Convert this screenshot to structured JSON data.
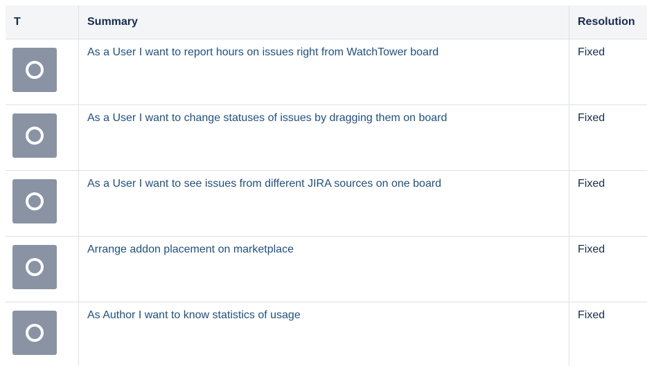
{
  "table": {
    "headers": {
      "type": "T",
      "summary": "Summary",
      "resolution": "Resolution"
    },
    "rows": [
      {
        "icon": "status-open-icon",
        "summary": "As a User I want to report hours on issues right from WatchTower board",
        "resolution": "Fixed"
      },
      {
        "icon": "status-open-icon",
        "summary": "As a User I want to change statuses of issues by dragging them on board",
        "resolution": "Fixed"
      },
      {
        "icon": "status-open-icon",
        "summary": "As a User I want to see issues from different JIRA sources on one board",
        "resolution": "Fixed"
      },
      {
        "icon": "status-open-icon",
        "summary": "Arrange addon placement on marketplace",
        "resolution": "Fixed"
      },
      {
        "icon": "status-open-icon",
        "summary": "As Author I want to know statistics of usage",
        "resolution": "Fixed"
      }
    ]
  },
  "colors": {
    "header_bg": "#f4f5f7",
    "link": "#205081",
    "icon_bg": "#8993a4"
  }
}
